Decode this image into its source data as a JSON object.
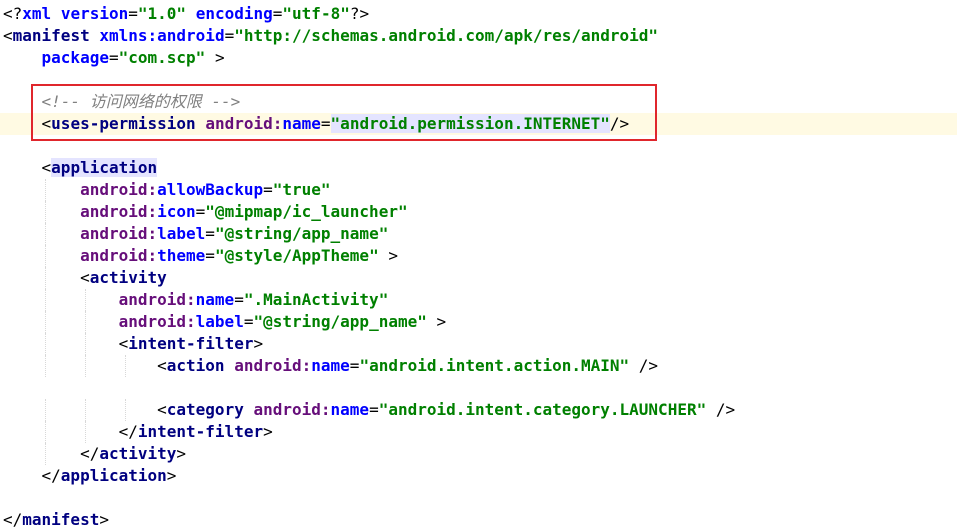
{
  "editor": {
    "lines": [
      {
        "indent": 0,
        "tokens": [
          {
            "t": "<?",
            "c": "punct"
          },
          {
            "t": "xml",
            "c": "attr"
          },
          {
            "t": " ",
            "c": "punct"
          },
          {
            "t": "version",
            "c": "attr"
          },
          {
            "t": "=",
            "c": "punct"
          },
          {
            "t": "\"1.0\"",
            "c": "val"
          },
          {
            "t": " ",
            "c": "punct"
          },
          {
            "t": "encoding",
            "c": "attr"
          },
          {
            "t": "=",
            "c": "punct"
          },
          {
            "t": "\"utf-8\"",
            "c": "val"
          },
          {
            "t": "?>",
            "c": "punct"
          }
        ]
      },
      {
        "indent": 0,
        "tokens": [
          {
            "t": "<",
            "c": "punct"
          },
          {
            "t": "manifest",
            "c": "tag"
          },
          {
            "t": " ",
            "c": "punct"
          },
          {
            "t": "xmlns:android",
            "c": "attr"
          },
          {
            "t": "=",
            "c": "punct"
          },
          {
            "t": "\"http://schemas.android.com/apk/res/android\"",
            "c": "val"
          }
        ]
      },
      {
        "indent": 1,
        "tokens": [
          {
            "t": "package",
            "c": "attr"
          },
          {
            "t": "=",
            "c": "punct"
          },
          {
            "t": "\"com.scp\"",
            "c": "val"
          },
          {
            "t": " >",
            "c": "punct"
          }
        ]
      },
      {
        "indent": 0,
        "tokens": []
      },
      {
        "indent": 1,
        "tokens": [
          {
            "t": "<!-- 访问网络的权限 -->",
            "c": "comment"
          }
        ]
      },
      {
        "indent": 1,
        "current": true,
        "tokens": [
          {
            "t": "<",
            "c": "punct"
          },
          {
            "t": "uses-permission",
            "c": "tag"
          },
          {
            "t": " ",
            "c": "punct"
          },
          {
            "t": "android:",
            "c": "attr-ns"
          },
          {
            "t": "name",
            "c": "attr"
          },
          {
            "t": "=",
            "c": "punct"
          },
          {
            "t": "\"android.permission.INTERNET\"",
            "c": "val",
            "hl": true
          },
          {
            "t": "/>",
            "c": "punct"
          }
        ]
      },
      {
        "indent": 0,
        "tokens": []
      },
      {
        "indent": 1,
        "tokens": [
          {
            "t": "<",
            "c": "punct"
          },
          {
            "t": "application",
            "c": "tag",
            "hl": true
          }
        ]
      },
      {
        "indent": 2,
        "tokens": [
          {
            "t": "android:",
            "c": "attr-ns"
          },
          {
            "t": "allowBackup",
            "c": "attr"
          },
          {
            "t": "=",
            "c": "punct"
          },
          {
            "t": "\"true\"",
            "c": "val"
          }
        ]
      },
      {
        "indent": 2,
        "tokens": [
          {
            "t": "android:",
            "c": "attr-ns"
          },
          {
            "t": "icon",
            "c": "attr"
          },
          {
            "t": "=",
            "c": "punct"
          },
          {
            "t": "\"@mipmap/ic_launcher\"",
            "c": "val"
          }
        ]
      },
      {
        "indent": 2,
        "tokens": [
          {
            "t": "android:",
            "c": "attr-ns"
          },
          {
            "t": "label",
            "c": "attr"
          },
          {
            "t": "=",
            "c": "punct"
          },
          {
            "t": "\"@string/app_name\"",
            "c": "val"
          }
        ]
      },
      {
        "indent": 2,
        "tokens": [
          {
            "t": "android:",
            "c": "attr-ns"
          },
          {
            "t": "theme",
            "c": "attr"
          },
          {
            "t": "=",
            "c": "punct"
          },
          {
            "t": "\"@style/AppTheme\"",
            "c": "val"
          },
          {
            "t": " >",
            "c": "punct"
          }
        ]
      },
      {
        "indent": 2,
        "tokens": [
          {
            "t": "<",
            "c": "punct"
          },
          {
            "t": "activity",
            "c": "tag"
          }
        ]
      },
      {
        "indent": 3,
        "tokens": [
          {
            "t": "android:",
            "c": "attr-ns"
          },
          {
            "t": "name",
            "c": "attr"
          },
          {
            "t": "=",
            "c": "punct"
          },
          {
            "t": "\".MainActivity\"",
            "c": "val"
          }
        ]
      },
      {
        "indent": 3,
        "tokens": [
          {
            "t": "android:",
            "c": "attr-ns"
          },
          {
            "t": "label",
            "c": "attr"
          },
          {
            "t": "=",
            "c": "punct"
          },
          {
            "t": "\"@string/app_name\"",
            "c": "val"
          },
          {
            "t": " >",
            "c": "punct"
          }
        ]
      },
      {
        "indent": 3,
        "tokens": [
          {
            "t": "<",
            "c": "punct"
          },
          {
            "t": "intent-filter",
            "c": "tag"
          },
          {
            "t": ">",
            "c": "punct"
          }
        ]
      },
      {
        "indent": 4,
        "tokens": [
          {
            "t": "<",
            "c": "punct"
          },
          {
            "t": "action",
            "c": "tag"
          },
          {
            "t": " ",
            "c": "punct"
          },
          {
            "t": "android:",
            "c": "attr-ns"
          },
          {
            "t": "name",
            "c": "attr"
          },
          {
            "t": "=",
            "c": "punct"
          },
          {
            "t": "\"android.intent.action.MAIN\"",
            "c": "val"
          },
          {
            "t": " />",
            "c": "punct"
          }
        ]
      },
      {
        "indent": 0,
        "tokens": []
      },
      {
        "indent": 4,
        "tokens": [
          {
            "t": "<",
            "c": "punct"
          },
          {
            "t": "category",
            "c": "tag"
          },
          {
            "t": " ",
            "c": "punct"
          },
          {
            "t": "android:",
            "c": "attr-ns"
          },
          {
            "t": "name",
            "c": "attr"
          },
          {
            "t": "=",
            "c": "punct"
          },
          {
            "t": "\"android.intent.category.LAUNCHER\"",
            "c": "val"
          },
          {
            "t": " />",
            "c": "punct"
          }
        ]
      },
      {
        "indent": 3,
        "tokens": [
          {
            "t": "</",
            "c": "punct"
          },
          {
            "t": "intent-filter",
            "c": "tag"
          },
          {
            "t": ">",
            "c": "punct"
          }
        ]
      },
      {
        "indent": 2,
        "tokens": [
          {
            "t": "</",
            "c": "punct"
          },
          {
            "t": "activity",
            "c": "tag"
          },
          {
            "t": ">",
            "c": "punct"
          }
        ]
      },
      {
        "indent": 1,
        "tokens": [
          {
            "t": "</",
            "c": "punct"
          },
          {
            "t": "application",
            "c": "tag"
          },
          {
            "t": ">",
            "c": "punct"
          }
        ]
      },
      {
        "indent": 0,
        "tokens": []
      },
      {
        "indent": 0,
        "tokens": [
          {
            "t": "</",
            "c": "punct"
          },
          {
            "t": "manifest",
            "c": "tag"
          },
          {
            "t": ">",
            "c": "punct"
          }
        ]
      }
    ]
  },
  "colors": {
    "tag": "#000080",
    "attribute": "#0000ff",
    "namespace": "#660e7a",
    "value": "#008000",
    "comment": "#808080",
    "highlight_box": "#e0262c",
    "current_line": "#fffae3"
  }
}
